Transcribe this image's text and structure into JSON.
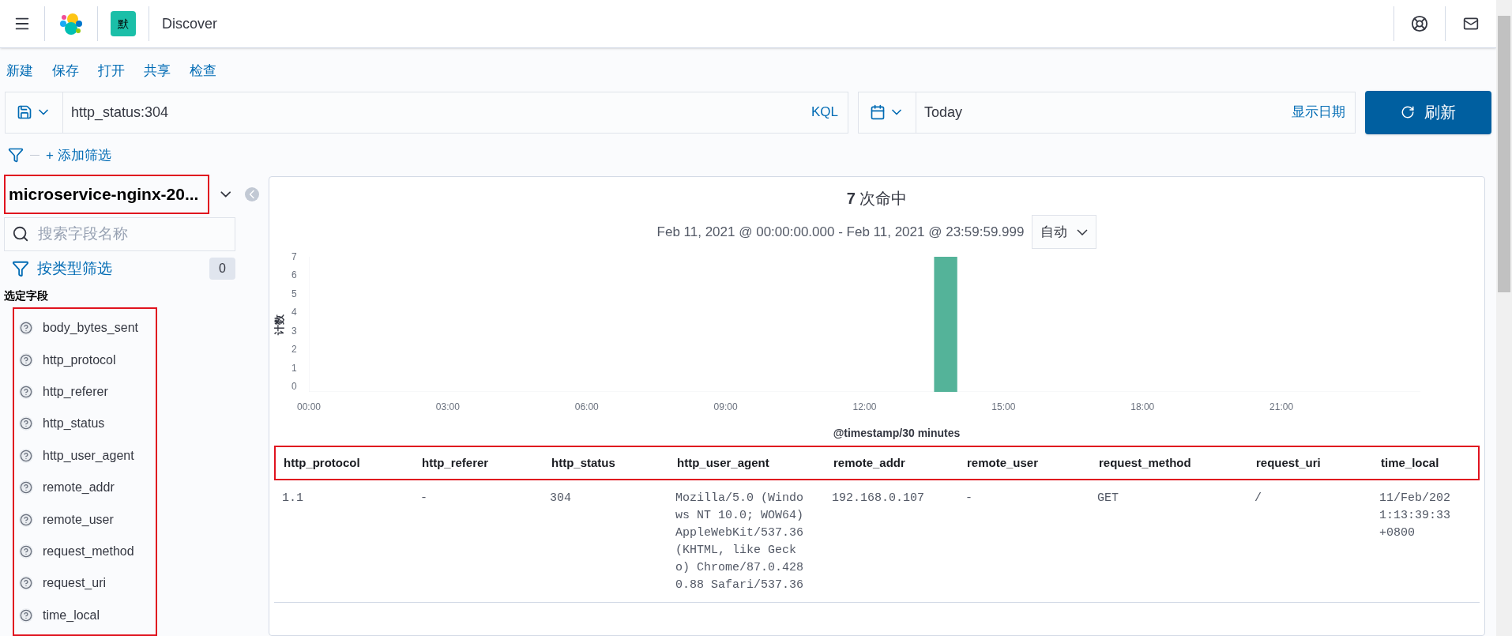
{
  "header": {
    "space_badge": "默",
    "title": "Discover"
  },
  "menu": [
    "新建",
    "保存",
    "打开",
    "共享",
    "检查"
  ],
  "query": {
    "value": "http_status:304",
    "language": "KQL"
  },
  "date": {
    "value": "Today",
    "show_dates": "显示日期"
  },
  "refresh_button": "刷新",
  "add_filter": "+ 添加筛选",
  "sidebar": {
    "index_pattern": "microservice-nginx-20...",
    "search": {
      "placeholder": "搜索字段名称"
    },
    "filter_by_type": "按类型筛选",
    "filter_count": "0",
    "selected_heading": "选定字段",
    "fields": [
      "body_bytes_sent",
      "http_protocol",
      "http_referer",
      "http_status",
      "http_user_agent",
      "remote_addr",
      "remote_user",
      "request_method",
      "request_uri",
      "time_local"
    ]
  },
  "hits": {
    "count": "7",
    "label": "次命中"
  },
  "time_range": "Feb 11, 2021 @ 00:00:00.000 - Feb 11, 2021 @ 23:59:59.999",
  "interval": "自动",
  "chart_data": {
    "type": "bar",
    "xlabel": "@timestamp/30 minutes",
    "ylabel": "计数",
    "x": [
      13.75
    ],
    "values": [
      7
    ],
    "xlim": [
      0,
      24
    ],
    "ylim": [
      0,
      7
    ],
    "xticks": [
      {
        "value": 0,
        "label": "00:00"
      },
      {
        "value": 3,
        "label": "03:00"
      },
      {
        "value": 6,
        "label": "06:00"
      },
      {
        "value": 9,
        "label": "09:00"
      },
      {
        "value": 12,
        "label": "12:00"
      },
      {
        "value": 15,
        "label": "15:00"
      },
      {
        "value": 18,
        "label": "18:00"
      },
      {
        "value": 21,
        "label": "21:00"
      }
    ],
    "yticks": [
      0,
      1,
      2,
      3,
      4,
      5,
      6,
      7
    ]
  },
  "table": {
    "columns": [
      "http_protocol",
      "http_referer",
      "http_status",
      "http_user_agent",
      "remote_addr",
      "remote_user",
      "request_method",
      "request_uri",
      "time_local"
    ],
    "rows": [
      [
        "1.1",
        "-",
        "304",
        "Mozilla/5.0 (Windows NT 10.0; WOW64) AppleWebKit/537.36 (KHTML, like Gecko) Chrome/87.0.4280.88 Safari/537.36",
        "192.168.0.107",
        "-",
        "GET",
        "/",
        "11/Feb/2021:13:39:33 +0800"
      ]
    ]
  }
}
